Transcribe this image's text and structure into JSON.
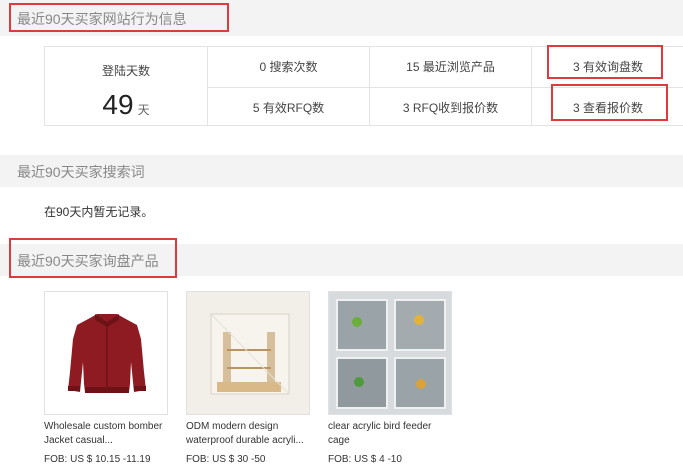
{
  "behavior": {
    "title": "最近90天买家网站行为信息",
    "login_days_label": "登陆天数",
    "login_days_value": "49",
    "login_days_unit": "天",
    "stats": [
      "0 搜索次数",
      "15 最近浏览产品",
      "3 有效询盘数",
      "5 有效RFQ数",
      "3 RFQ收到报价数",
      "3 查看报价数"
    ]
  },
  "search_terms": {
    "title": "最近90天买家搜索词",
    "empty_text": "在90天内暂无记录。"
  },
  "inquiry_products": {
    "title": "最近90天买家询盘产品",
    "items": [
      {
        "name": "Wholesale custom bomber Jacket casual...",
        "price": "FOB: US $ 10.15 -11.19",
        "image": "red-bomber-jacket"
      },
      {
        "name": "ODM modern design waterproof durable acryli...",
        "price": "FOB: US $ 30 -50",
        "image": "acrylic-bird-cage"
      },
      {
        "name": "clear acrylic bird feeder cage",
        "price": "FOB: US $ 4 -10",
        "image": "acrylic-bird-feeder-grid"
      }
    ]
  },
  "colors": {
    "highlight": "#e0393e",
    "section_bg": "#f3f3f3",
    "border": "#e3e3e3"
  }
}
